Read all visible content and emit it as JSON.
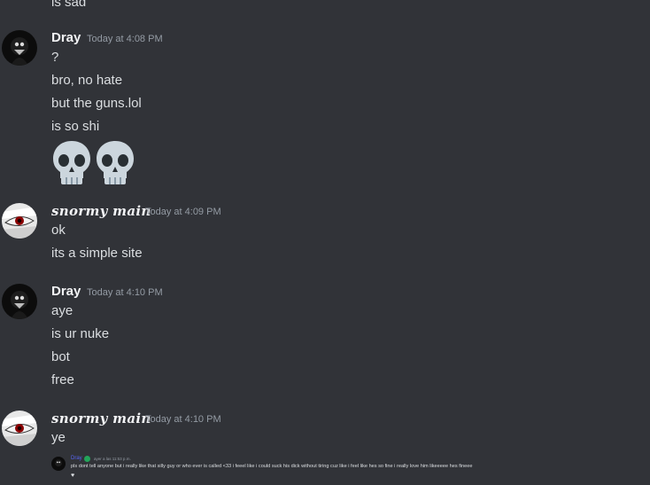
{
  "top_partial_text": "is sad",
  "messages": [
    {
      "author": "Dray",
      "timestamp": "Today at 4:08 PM",
      "lines": [
        "?",
        "bro, no hate",
        "but the guns.lol",
        "is so shi"
      ],
      "emojis": [
        "skull-emoji",
        "skull-emoji"
      ]
    },
    {
      "author": "snormy main",
      "timestamp": "Today at 4:09 PM",
      "lines": [
        "ok",
        "its a simple site"
      ]
    },
    {
      "author": "Dray",
      "timestamp": "Today at 4:10 PM",
      "lines": [
        "aye",
        "is ur nuke",
        "bot",
        "free"
      ]
    },
    {
      "author": "snormy main",
      "timestamp": "Today at 4:10 PM",
      "lines": [
        "ye"
      ]
    }
  ],
  "embedded_screenshot": {
    "author": "Dray",
    "timestamp": "ayer a las 11:53 p.m.",
    "text": "pls dont tell anyone but i really like that silly guy or who ever is called <33 i feeel like i could suck his dick without tiring cuz like i feel like hes so fine i really love him likeeeee hes fineee",
    "heart": "♥"
  },
  "colors": {
    "background": "#313338",
    "text": "#dbdee1",
    "username": "#f2f3f5",
    "timestamp": "#949ba4",
    "link_blue": "#5865f2",
    "status_green": "#23a55a"
  }
}
